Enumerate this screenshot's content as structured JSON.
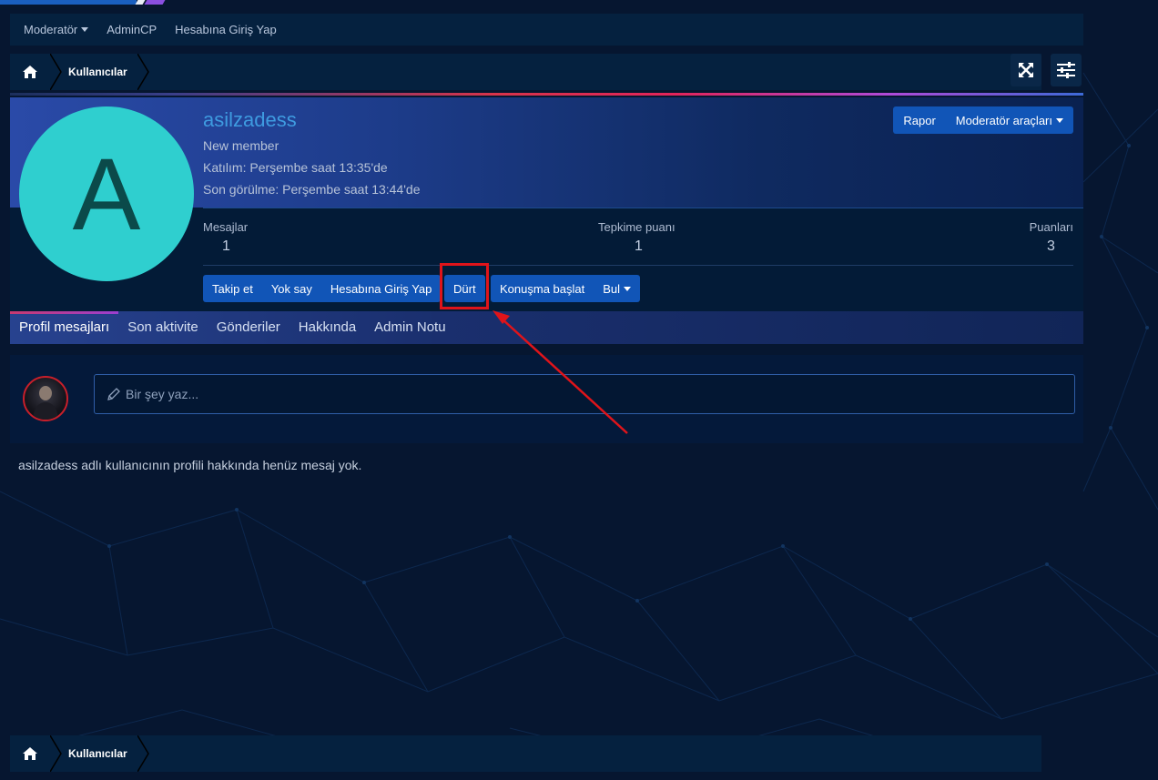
{
  "subnav": {
    "items": [
      "Moderatör",
      "AdminCP",
      "Hesabına Giriş Yap"
    ]
  },
  "breadcrumb": {
    "label": "Kullanıcılar"
  },
  "profile": {
    "avatar_letter": "A",
    "username": "asilzadess",
    "user_title": "New member",
    "joined_label": "Katılım:",
    "joined_value": "Perşembe saat 13:35'de",
    "last_seen_label": "Son görülme:",
    "last_seen_value": "Perşembe saat 13:44'de",
    "report_label": "Rapor",
    "mod_tools_label": "Moderatör araçları",
    "stats": [
      {
        "label": "Mesajlar",
        "value": "1"
      },
      {
        "label": "Tepkime puanı",
        "value": "1"
      },
      {
        "label": "Puanları",
        "value": "3"
      }
    ],
    "actions_a": [
      "Takip et",
      "Yok say",
      "Hesabına Giriş Yap"
    ],
    "poke_label": "Dürt",
    "actions_b": [
      "Konuşma başlat",
      "Bul"
    ]
  },
  "tabs": [
    "Profil mesajları",
    "Son aktivite",
    "Gönderiler",
    "Hakkında",
    "Admin Notu"
  ],
  "composer": {
    "placeholder": "Bir şey yaz..."
  },
  "empty_message": "asilzadess adlı kullanıcının profili hakkında henüz mesaj yok.",
  "colors": {
    "page_bg": "#061630",
    "accent_blue": "#1155b7",
    "avatar_bg": "#2fcfcf",
    "highlight_red": "#e0141a",
    "username": "#3e9be0"
  }
}
